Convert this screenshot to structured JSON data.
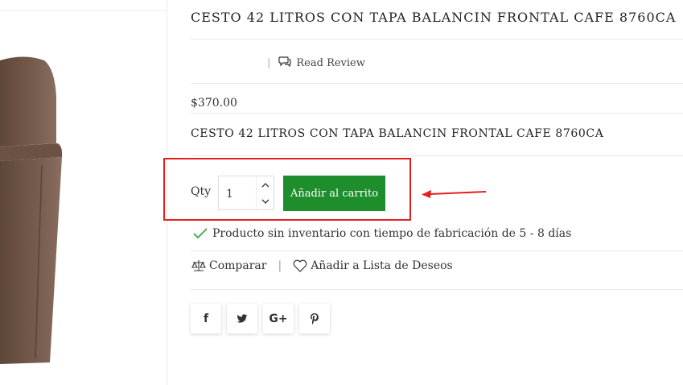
{
  "product": {
    "title": "CESTO 42 LITROS CON TAPA BALANCIN FRONTAL CAFE 8760CA",
    "review_separator": "|",
    "read_review": "Read Review",
    "price": "$370.00",
    "description": "CESTO 42 LITROS CON TAPA BALANCIN FRONTAL CAFE 8760CA"
  },
  "purchase": {
    "qty_label": "Qty",
    "qty_value": "1",
    "add_to_cart": "Añadir al carrito"
  },
  "stock": {
    "message": "Producto sin inventario con tiempo de fabricación de 5 - 8 días"
  },
  "actions": {
    "compare": "Comparar",
    "separator": "|",
    "wishlist": "Añadir a Lista de Deseos"
  },
  "social": {
    "facebook": "f",
    "twitter_icon": "twitter-icon",
    "googleplus": "G+",
    "pinterest": "P"
  },
  "colors": {
    "cart_button": "#1e8e2d",
    "annotation": "#e51e1e",
    "check": "#4caf50",
    "bin": "#7a6052"
  }
}
